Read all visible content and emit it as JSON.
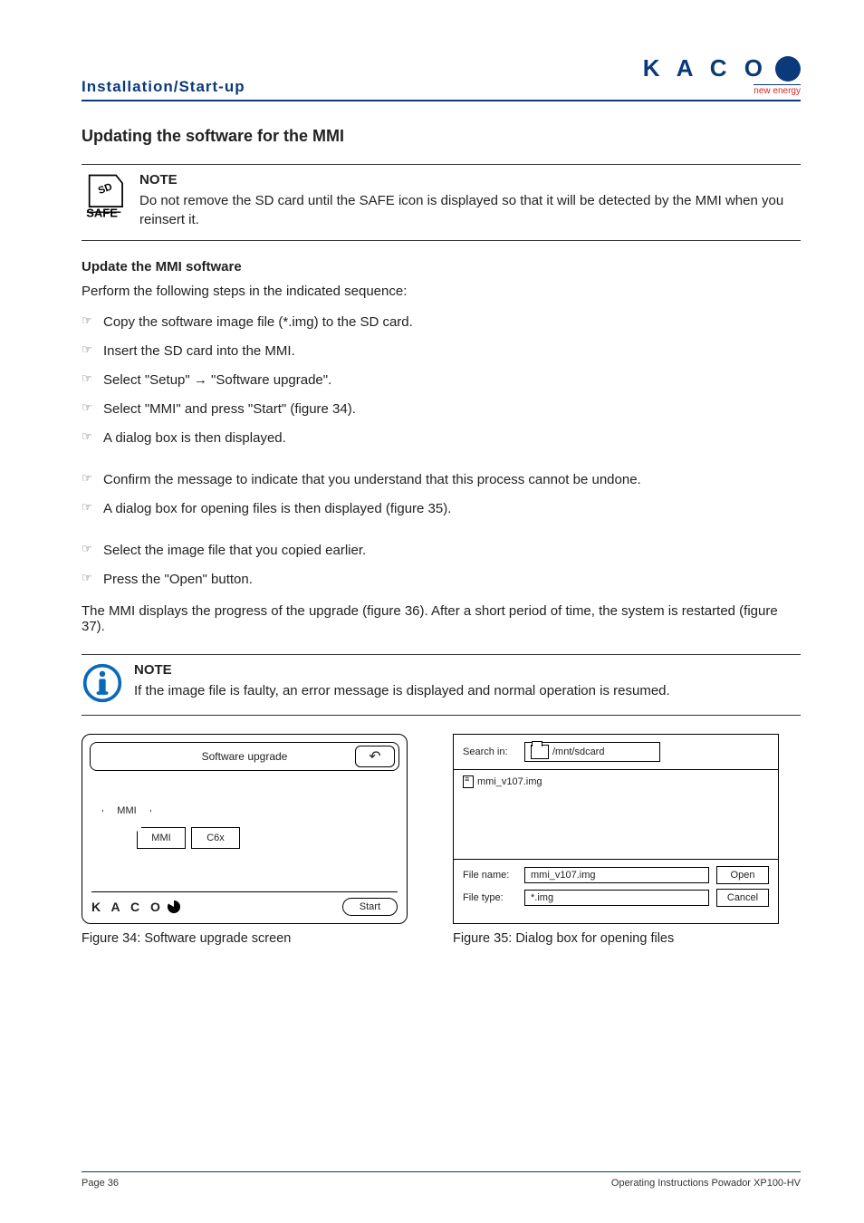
{
  "header": {
    "section": "Installation/Start-up",
    "brand": "K A C O",
    "tagline": "new energy"
  },
  "title": "Updating the software for the MMI",
  "note1": {
    "label": "NOTE",
    "text": "Do not remove the SD card until the SAFE icon is displayed so that it will be detected by the MMI when you reinsert it."
  },
  "update_heading": "Update the MMI software",
  "intro": "Perform the following steps in the indicated sequence:",
  "steps_a": [
    "Copy the software image file (*.img) to the SD card.",
    "Insert the SD card into the MMI.",
    "Select \"Setup\" → \"Software upgrade\".",
    "Select \"MMI\" and press \"Start\" (figure 34).",
    "A dialog box is then displayed."
  ],
  "steps_b": [
    "Confirm the message to indicate that you understand that this process cannot be undone.",
    "A dialog box for opening files is then displayed (figure 35)."
  ],
  "steps_c": [
    "Select the image file that you copied earlier.",
    "Press the \"Open\" button."
  ],
  "after_text": "The MMI displays the progress of the upgrade (figure 36). After a short period of time, the system is restarted (figure 37).",
  "note2": {
    "label": "NOTE",
    "text": "If the image file is faulty, an error message is displayed and normal operation is resumed."
  },
  "fig34": {
    "title": "Software upgrade",
    "hex": "MMI",
    "tab1": "MMI",
    "tab2": "C6x",
    "brand": "K A C O",
    "start": "Start",
    "back": "↶",
    "caption": "Figure 34:  Software upgrade screen"
  },
  "fig35": {
    "search_label": "Search in:",
    "search_value": "/mnt/sdcard",
    "list_item": "mmi_v107.img",
    "filename_label": "File name:",
    "filename_value": "mmi_v107.img",
    "filetype_label": "File type:",
    "filetype_value": "*.img",
    "open": "Open",
    "cancel": "Cancel",
    "caption": "Figure 35:  Dialog box for opening files"
  },
  "footer": {
    "left": "Page 36",
    "right": "Operating Instructions Powador XP100-HV"
  }
}
